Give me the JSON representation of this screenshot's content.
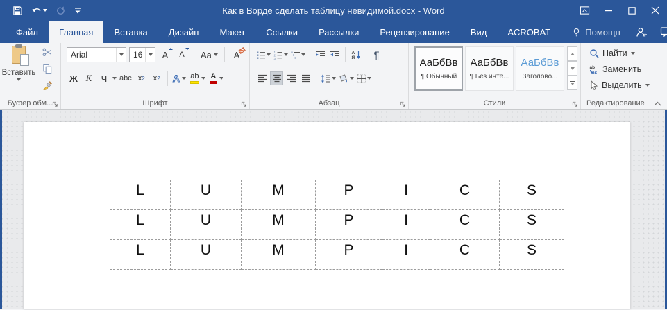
{
  "window": {
    "title": "Как в Ворде сделать таблицу невидимой.docx - Word"
  },
  "tabs": [
    {
      "id": "file",
      "label": "Файл",
      "active": false
    },
    {
      "id": "home",
      "label": "Главная",
      "active": true
    },
    {
      "id": "insert",
      "label": "Вставка",
      "active": false
    },
    {
      "id": "design",
      "label": "Дизайн",
      "active": false
    },
    {
      "id": "layout",
      "label": "Макет",
      "active": false
    },
    {
      "id": "references",
      "label": "Ссылки",
      "active": false
    },
    {
      "id": "mailings",
      "label": "Рассылки",
      "active": false
    },
    {
      "id": "review",
      "label": "Рецензирование",
      "active": false
    },
    {
      "id": "view",
      "label": "Вид",
      "active": false
    },
    {
      "id": "acrobat",
      "label": "ACROBAT",
      "active": false
    },
    {
      "id": "assistant",
      "label": "Помощн",
      "active": false,
      "icon": "lightbulb"
    }
  ],
  "ribbon": {
    "clipboard": {
      "group_label": "Буфер обм...",
      "paste_label": "Вставить"
    },
    "font": {
      "group_label": "Шрифт",
      "font_name": "Arial",
      "font_size": "16",
      "grow_label": "A",
      "shrink_label": "A",
      "change_case_label": "Aa",
      "clear_format_label": "А",
      "bold_label": "Ж",
      "italic_label": "К",
      "underline_label": "Ч",
      "strikethrough_label": "abc",
      "subscript_base": "x",
      "subscript_digit": "2",
      "superscript_base": "x",
      "superscript_digit": "2",
      "text_effects_label": "А",
      "highlight_label": "ab",
      "font_color_label": "А"
    },
    "paragraph": {
      "group_label": "Абзац",
      "pilcrow": "¶",
      "sort_a": "А",
      "sort_z": "Я"
    },
    "styles": {
      "group_label": "Стили",
      "items": [
        {
          "preview": "АаБбВв",
          "name": "¶ Обычный",
          "selected": true,
          "accent": false
        },
        {
          "preview": "АаБбВв",
          "name": "¶ Без инте...",
          "selected": false,
          "accent": false
        },
        {
          "preview": "АаБбВв",
          "name": "Заголово...",
          "selected": false,
          "accent": true
        }
      ]
    },
    "editing": {
      "group_label": "Редактирование",
      "find_label": "Найти",
      "replace_label": "Заменить",
      "select_label": "Выделить"
    }
  },
  "document": {
    "table_rows": [
      [
        "L",
        "U",
        "M",
        "P",
        "I",
        "C",
        "S"
      ],
      [
        "L",
        "U",
        "M",
        "P",
        "I",
        "C",
        "S"
      ],
      [
        "L",
        "U",
        "M",
        "P",
        "I",
        "C",
        "S"
      ]
    ]
  },
  "colors": {
    "accent": "#2b579a",
    "ribbon_bg": "#f3f4f6",
    "table_border": "#9c9c9c",
    "highlight_yellow": "#ffe400",
    "font_color_red": "#c00000",
    "style_accent_blue": "#5b9bd5"
  }
}
